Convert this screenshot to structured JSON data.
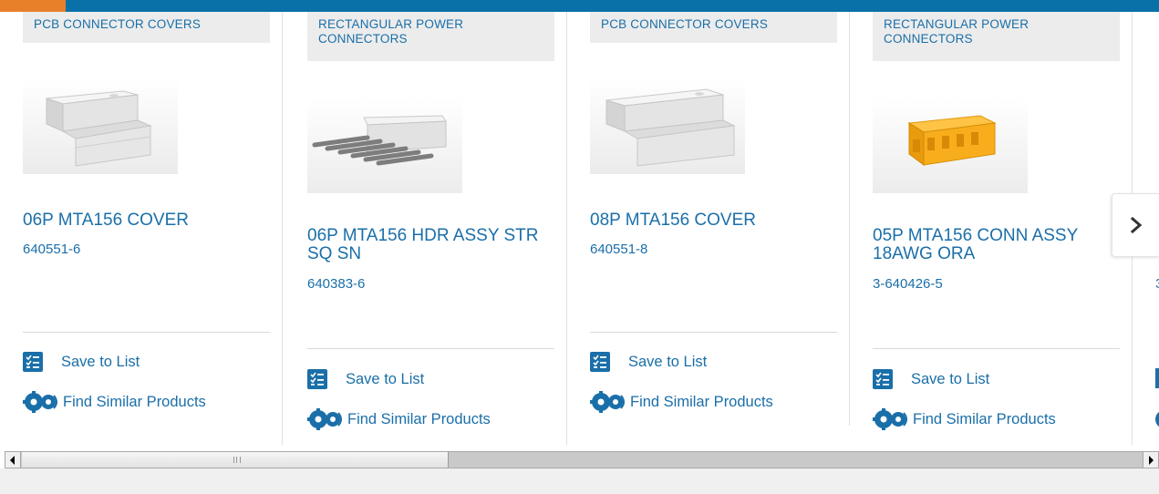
{
  "colors": {
    "brand_blue": "#1a6fa9",
    "top_bar": "#0a71a8",
    "accent_orange": "#e8802a"
  },
  "products": [
    {
      "category": "PCB CONNECTOR COVERS",
      "name": "06P MTA156 COVER",
      "part_number": "640551-6",
      "image": "white-cover-image",
      "save_label": "Save to List",
      "similar_label": "Find Similar Products"
    },
    {
      "category": "RECTANGULAR POWER CONNECTORS",
      "name": "06P MTA156 HDR ASSY STR SQ SN",
      "part_number": "640383-6",
      "image": "header-pins-image",
      "save_label": "Save to List",
      "similar_label": "Find Similar Products"
    },
    {
      "category": "PCB CONNECTOR COVERS",
      "name": "08P MTA156 COVER",
      "part_number": "640551-8",
      "image": "white-cover-image",
      "save_label": "Save to List",
      "similar_label": "Find Similar Products"
    },
    {
      "category": "RECTANGULAR POWER CONNECTORS",
      "name": "05P MTA156 CONN ASSY 18AWG ORA",
      "part_number": "3-640426-5",
      "image": "orange-connector-image",
      "save_label": "Save to List",
      "similar_label": "Find Similar Products"
    }
  ],
  "partial_card": {
    "part_number_fragment": "3"
  },
  "icons": {
    "save": "checklist-icon",
    "similar": "gears-icon",
    "next": "chevron-right-icon"
  }
}
